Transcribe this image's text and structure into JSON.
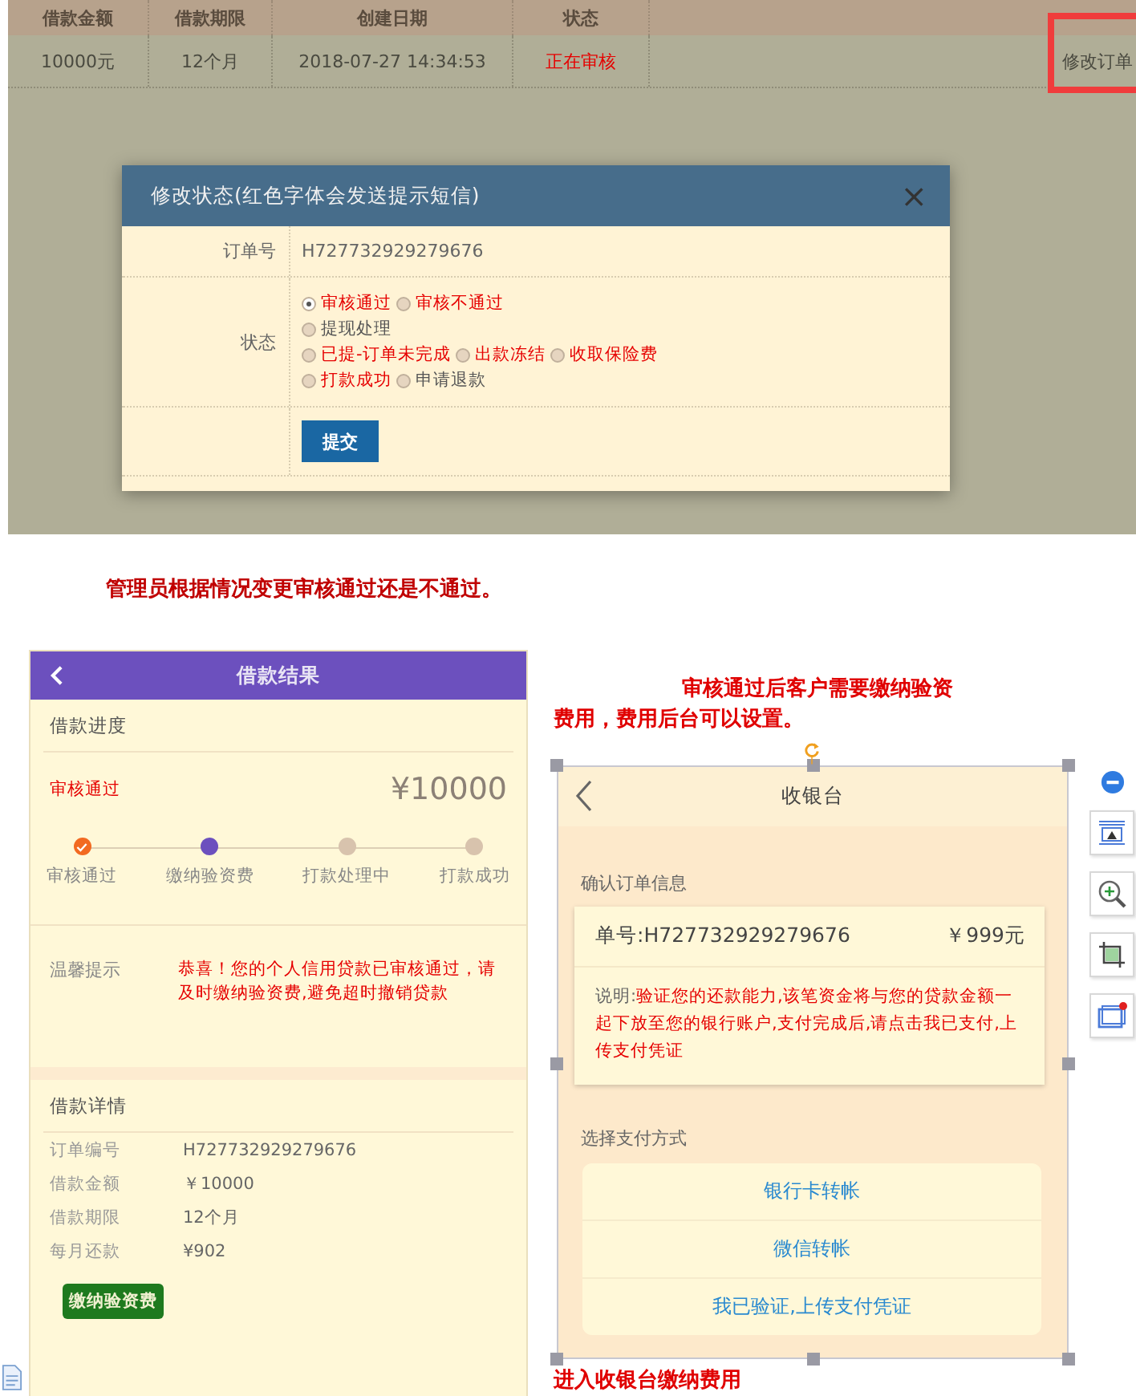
{
  "admin": {
    "columns": [
      "借款金额",
      "借款期限",
      "创建日期",
      "状态"
    ],
    "row": {
      "amount": "10000元",
      "term": "12个月",
      "created": "2018-07-27 14:34:53",
      "status": "正在审核",
      "action": "修改订单"
    },
    "modal": {
      "title": "修改状态(红色字体会发送提示短信)",
      "close": "×",
      "order_label": "订单号",
      "order_no": "H727732929279676",
      "status_label": "状态",
      "status_lines": [
        [
          {
            "label": "审核通过",
            "selected": true,
            "color": "#e60000"
          },
          {
            "label": "审核不通过",
            "selected": false,
            "color": "#e60000"
          }
        ],
        [
          {
            "label": "提现处理",
            "selected": false,
            "color": "#555555"
          }
        ],
        [
          {
            "label": "已提-订单未完成",
            "selected": false,
            "color": "#e60000"
          },
          {
            "label": "出款冻结",
            "selected": false,
            "color": "#e60000"
          },
          {
            "label": "收取保险费",
            "selected": false,
            "color": "#e60000"
          }
        ],
        [
          {
            "label": "打款成功",
            "selected": false,
            "color": "#e60000"
          },
          {
            "label": "申请退款",
            "selected": false,
            "color": "#555555"
          }
        ]
      ],
      "submit": "提交"
    }
  },
  "caption_1": "管理员根据情况变更审核通过还是不通过。",
  "loan_result": {
    "title": "借款结果",
    "progress_title": "借款进度",
    "status": "审核通过",
    "amount": "¥10000",
    "steps": [
      {
        "label": "审核通过",
        "completed": true,
        "active": false
      },
      {
        "label": "缴纳验资费",
        "completed": false,
        "active": true
      },
      {
        "label": "打款处理中",
        "completed": false,
        "active": false
      },
      {
        "label": "打款成功",
        "completed": false,
        "active": false
      }
    ],
    "tip_label": "温馨提示",
    "tip": "恭喜！您的个人信用贷款已审核通过，请及时缴纳验资费,避免超时撤销贷款",
    "details_title": "借款详情",
    "details": [
      {
        "label": "订单编号",
        "value": "H727732929279676"
      },
      {
        "label": "借款金额",
        "value": "￥10000"
      },
      {
        "label": "借款期限",
        "value": "12个月"
      },
      {
        "label": "每月还款",
        "value": "¥902"
      }
    ],
    "pay_button": "缴纳验资费"
  },
  "caption_2": "审核通过后客户需要缴纳验资费用，费用后台可以设置。",
  "cashier": {
    "title": "收银台",
    "confirm_title": "确认订单信息",
    "order_no": "单号:H727732929279676",
    "price": "￥999元",
    "note_label": "说明:",
    "note": "验证您的还款能力,该笔资金将与您的贷款金额一起下放至您的银行账户,支付完成后,请点击我已支付,上传支付凭证",
    "method_title": "选择支付方式",
    "methods": [
      "银行卡转帐",
      "微信转帐",
      "我已验证,上传支付凭证"
    ]
  },
  "caption_3": "进入收银台缴纳费用"
}
